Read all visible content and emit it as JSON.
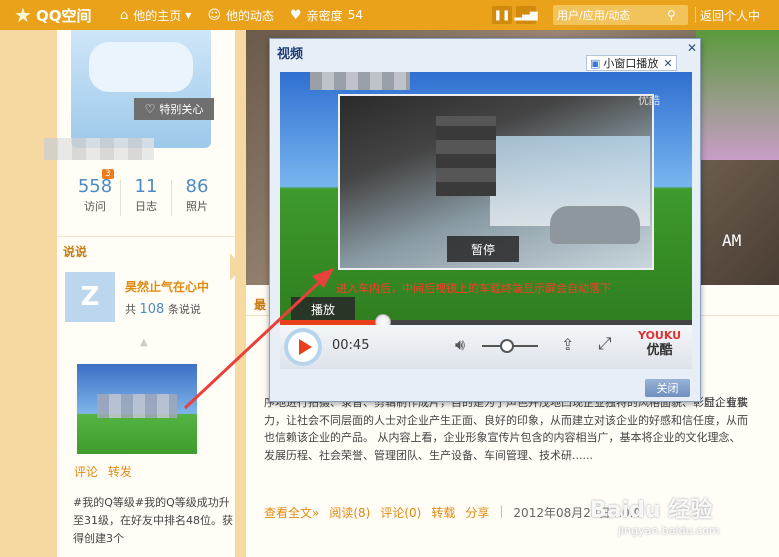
{
  "topbar": {
    "logo": "QQ空间",
    "nav_home": "他的主页",
    "nav_feed": "他的动态",
    "nav_intimacy": "亲密度",
    "intimacy_value": "54",
    "search_placeholder": "用户/应用/动态",
    "back_label": "返回个人中"
  },
  "profile": {
    "follow_label": "特别关心",
    "stats": [
      {
        "num": "558",
        "label": "访问",
        "badge": "3"
      },
      {
        "num": "11",
        "label": "日志"
      },
      {
        "num": "86",
        "label": "照片"
      }
    ]
  },
  "shuoshuo": {
    "header": "说说",
    "title": "昊然止气在心中",
    "count_prefix": "共",
    "count": "108",
    "count_suffix": "条说说",
    "link_comment": "评论",
    "link_repost": "转发",
    "text": "#我的Q等级#我的Q等级成功升至31级，在好友中排名48位。获得创建3个"
  },
  "post": {
    "header": "最",
    "text_line1": "序地进行拍摄、录音、剪辑制作成片，目的是为了声色并茂地凸现企业独特的风格面貌、彰显企业实力，让社会不同层面的人士对企业产生正面、良好的印象，从而建立对该企业的好感和信任度，从而也信赖该企业的产品。 从内容上看，企业形象宣传片包含的内容相当广，基本将企业的文化理念、发展历程、社会荣誉、管理团队、生产设备、车间管理、技术研......",
    "text_tail": "时、有秩",
    "link_full": "查看全文»",
    "link_read": "阅读(8)",
    "link_comment": "评论(0)",
    "link_repost": "转载",
    "link_share": "分享",
    "date": "2012年08月23日 10:0"
  },
  "banner": {
    "am": "AM"
  },
  "dialog": {
    "title": "视频",
    "mini_label": "小窗口播放",
    "pause_tip": "暂停",
    "play_tip": "播放",
    "subtitle": "进入车内后，中间后视镜上的车载终端显示屏会自动落下",
    "youku_watermark": "优酷",
    "time": "00:45",
    "youku_en": "YOUKU",
    "youku_cn": "优酷",
    "close_label": "关闭",
    "progress_fraction": 0.25,
    "volume_fraction": 0.45
  },
  "watermark": {
    "main": "Baidu 经验",
    "sub": "jingyan.baidu.com"
  }
}
